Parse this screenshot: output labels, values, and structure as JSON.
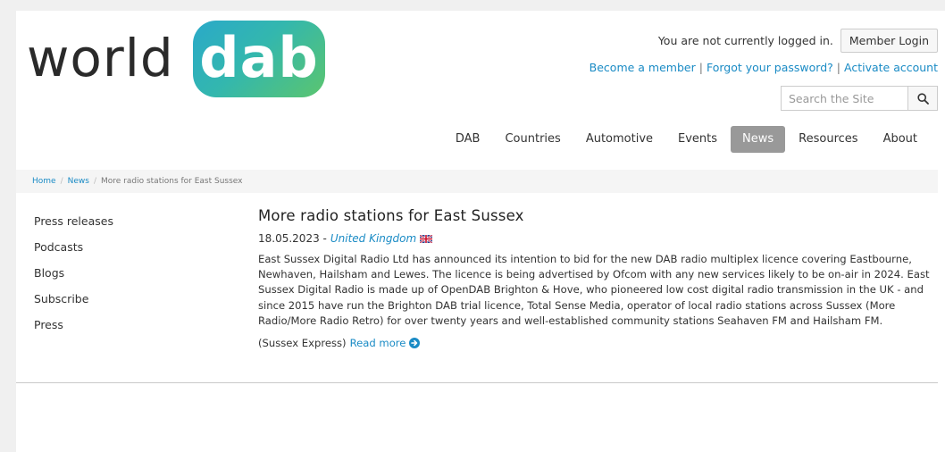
{
  "logo": {
    "word": "world",
    "badge": "dab"
  },
  "account": {
    "status": "You are not currently logged in.",
    "login_label": "Member Login",
    "links": [
      "Become a member",
      "Forgot your password?",
      "Activate account"
    ]
  },
  "search": {
    "placeholder": "Search the Site",
    "icon": "search-icon"
  },
  "nav": {
    "items": [
      "DAB",
      "Countries",
      "Automotive",
      "Events",
      "News",
      "Resources",
      "About"
    ],
    "active": "News"
  },
  "breadcrumb": {
    "home": "Home",
    "news": "News",
    "current": "More radio stations for East Sussex"
  },
  "sidebar": {
    "items": [
      "Press releases",
      "Podcasts",
      "Blogs",
      "Subscribe",
      "Press"
    ]
  },
  "article": {
    "title": "More radio stations for East Sussex",
    "date": "18.05.2023 -",
    "country": "United Kingdom",
    "body": "East Sussex Digital Radio Ltd has announced its intention to bid for the new DAB radio multiplex licence covering Eastbourne, Newhaven, Hailsham and Lewes. The licence is being advertised by Ofcom with any new services likely to be on-air in 2024. East Sussex Digital Radio is made up of OpenDAB Brighton & Hove, who pioneered low cost digital radio transmission in the UK - and since 2015 have run the Brighton DAB trial licence, Total Sense Media, operator of local radio stations across Sussex (More Radio/More Radio Retro) for over twenty years and well-established community stations Seahaven FM and Hailsham FM.",
    "source": "(Sussex Express)",
    "read_more": "Read more"
  },
  "colors": {
    "link": "#1a8bc5",
    "active_nav": "#999999",
    "logo_gradient_start": "#2aa9c9",
    "logo_gradient_end": "#5bc56e"
  }
}
